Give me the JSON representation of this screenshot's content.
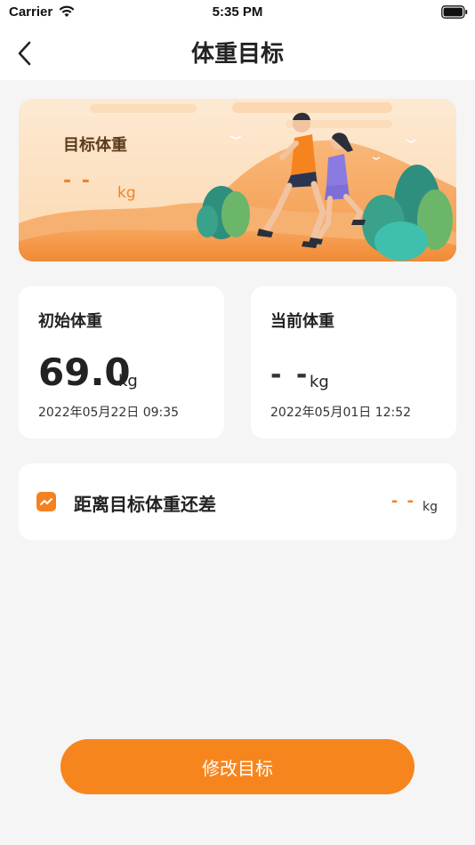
{
  "status_bar": {
    "carrier": "Carrier",
    "time": "5:35 PM"
  },
  "nav": {
    "title": "体重目标",
    "back_icon": "chevron-left-icon"
  },
  "banner": {
    "label": "目标体重",
    "value": "- -",
    "unit": "kg"
  },
  "initial_weight": {
    "label": "初始体重",
    "value": "69.0",
    "unit": "kg",
    "date": "2022年05月22日 09:35"
  },
  "current_weight": {
    "label": "当前体重",
    "value": "- -",
    "unit": "kg",
    "date": "2022年05月01日 12:52"
  },
  "difference": {
    "icon": "trend-chart-icon",
    "label": "距离目标体重还差",
    "value": "- -",
    "unit": "kg"
  },
  "action": {
    "button_label": "修改目标"
  },
  "colors": {
    "accent": "#f7851d",
    "background": "#f5f5f5"
  }
}
